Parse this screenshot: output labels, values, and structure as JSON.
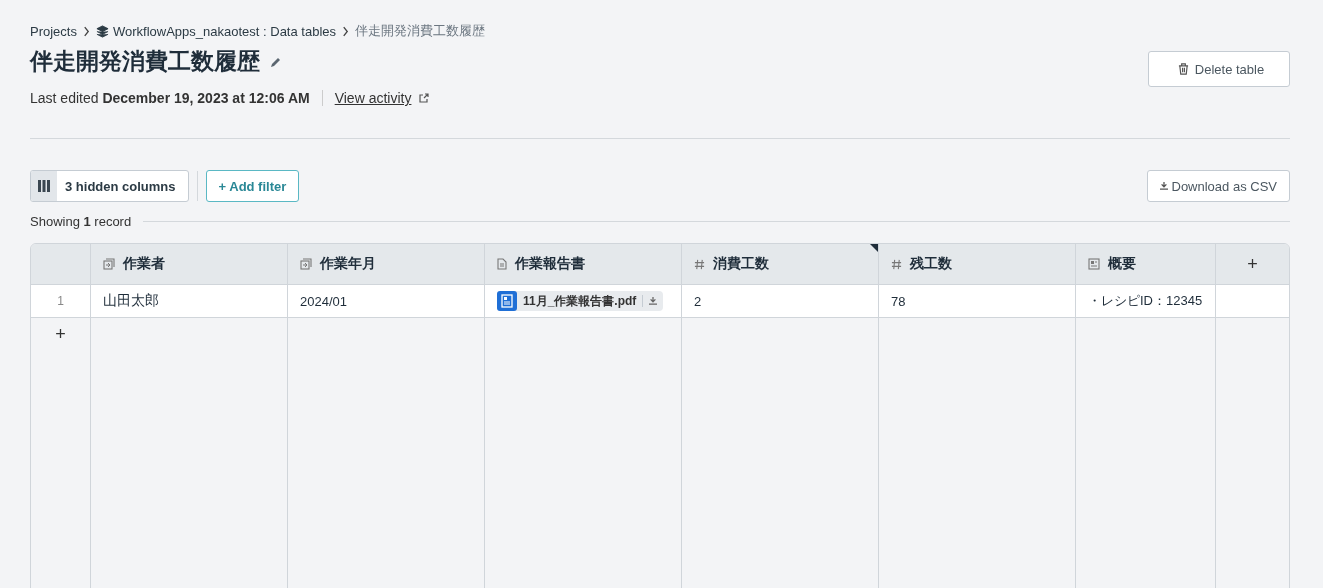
{
  "breadcrumb": [
    {
      "label": "Projects",
      "icon": false
    },
    {
      "label": "WorkflowApps_nakaotest : Data tables",
      "icon": true
    },
    {
      "label": "伴走開発消費工数履歴",
      "icon": false
    }
  ],
  "title": "伴走開発消費工数履歴",
  "last_edited": "Last edited **December 19, 2023 at 12:06 AM**",
  "view_activity": "View activity",
  "delete_button": "Delete table",
  "hidden_columns_button": "3 hidden columns",
  "add_filter_button": "+ Add filter",
  "download_button": "Download as CSV",
  "record_count": "Showing **1** record",
  "columns": [
    {
      "label": "作業者",
      "kind": "link"
    },
    {
      "label": "作業年月",
      "kind": "link"
    },
    {
      "label": "作業報告書",
      "kind": "file"
    },
    {
      "label": "消費工数",
      "kind": "number",
      "marked": true
    },
    {
      "label": "残工数",
      "kind": "number",
      "marked": false
    },
    {
      "label": "概要",
      "kind": "text"
    }
  ],
  "add_column": "+",
  "rows": [
    {
      "number": "1",
      "cells": [
        {
          "kind": "text",
          "value": "山田太郎"
        },
        {
          "kind": "text",
          "value": "2024/01"
        },
        {
          "kind": "file",
          "value": "11月_作業報告書.pdf"
        },
        {
          "kind": "text",
          "value": "2"
        },
        {
          "kind": "text",
          "value": "78"
        },
        {
          "kind": "text",
          "value": "・レシピID：12345"
        }
      ]
    }
  ],
  "add_row": "+"
}
